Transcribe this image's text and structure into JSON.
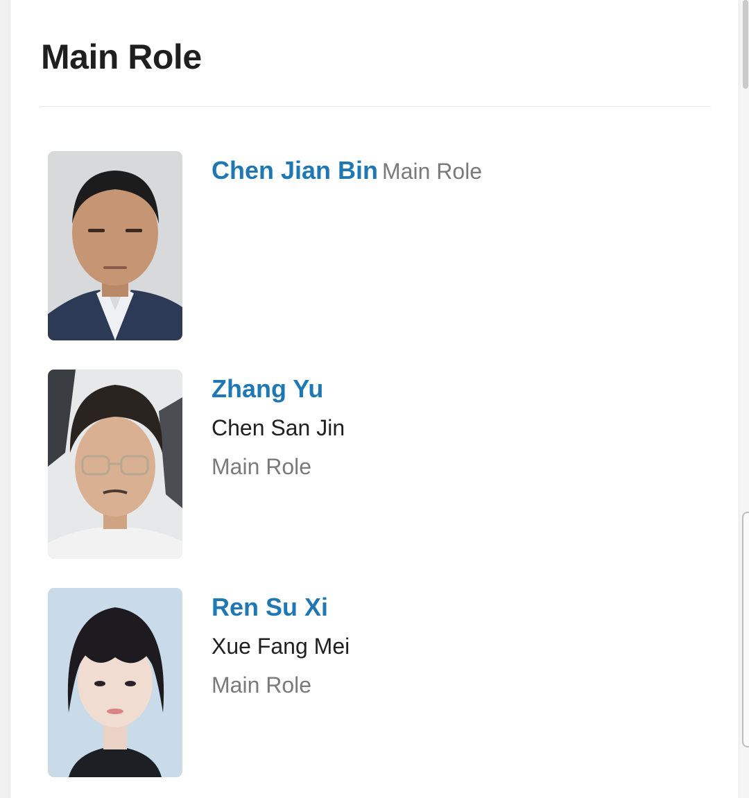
{
  "section": {
    "title": "Main Role"
  },
  "cast": [
    {
      "actor": "Chen Jian Bin",
      "character": "",
      "role": "Main Role"
    },
    {
      "actor": "Zhang Yu",
      "character": "Chen San Jin",
      "role": "Main Role"
    },
    {
      "actor": "Ren Su Xi",
      "character": "Xue Fang Mei",
      "role": "Main Role"
    }
  ],
  "colors": {
    "actor_link": "#1f78b4",
    "role_text": "#7a7a7a",
    "character_text": "#1f1f1f",
    "title_text": "#1f1f1f"
  }
}
